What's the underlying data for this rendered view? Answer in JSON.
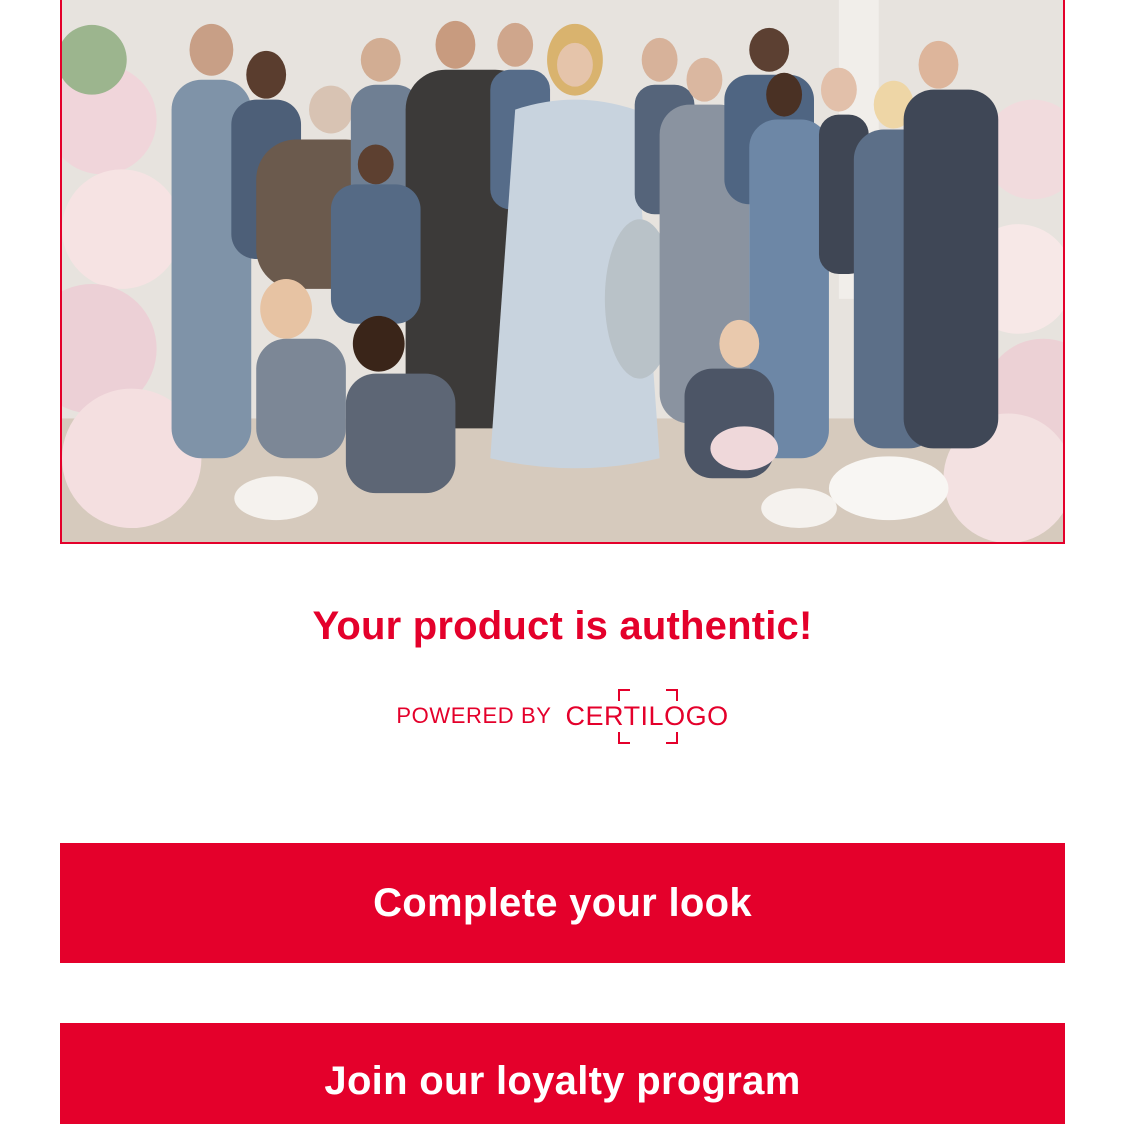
{
  "hero": {
    "image_label": "campaign-group-photo"
  },
  "result": {
    "headline": "Your product is authentic!",
    "powered_by": "POWERED BY",
    "brand": "CERTILOGO"
  },
  "actions": {
    "complete_look_label": "Complete your look",
    "loyalty_label": "Join our loyalty program"
  },
  "colors": {
    "accent": "#e4002b",
    "background": "#ffffff"
  }
}
